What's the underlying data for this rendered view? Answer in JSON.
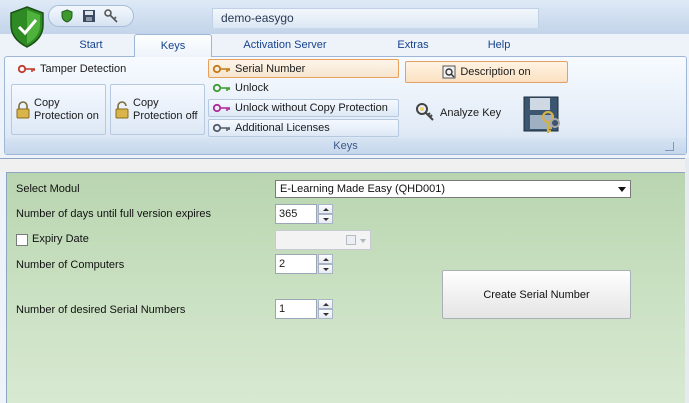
{
  "window": {
    "title": "demo-easygo"
  },
  "tabs": [
    {
      "label": "Start",
      "active": false
    },
    {
      "label": "Keys",
      "active": true
    },
    {
      "label": "Activation Server",
      "active": false
    },
    {
      "label": "Extras",
      "active": false
    },
    {
      "label": "Help",
      "active": false
    }
  ],
  "ribbon": {
    "group_label": "Keys",
    "tamper_detection": "Tamper Detection",
    "copy_protection_on": [
      "Copy",
      "Protection on"
    ],
    "copy_protection_off": [
      "Copy",
      "Protection off"
    ],
    "serial_number": "Serial Number",
    "unlock": "Unlock",
    "unlock_without_copy": "Unlock without Copy Protection",
    "additional_licenses": "Additional Licenses",
    "description_on": "Description on",
    "analyze_key": "Analyze Key"
  },
  "form": {
    "select_modul_label": "Select Modul",
    "select_modul_value": "E-Learning Made Easy (QHD001)",
    "days_label": "Number of days until full version expires",
    "days_value": "365",
    "expiry_label": "Expiry Date",
    "expiry_checked": false,
    "computers_label": "Number of Computers",
    "computers_value": "2",
    "serials_label": "Number of desired Serial Numbers",
    "serials_value": "1",
    "create_button": "Create Serial Number"
  },
  "colors": {
    "accent_blue": "#15428b",
    "form_green": "#c9e0c1",
    "key_red": "#c0392b",
    "key_green": "#3e9a2f",
    "key_magenta": "#b0289a",
    "key_gray": "#555e68"
  }
}
